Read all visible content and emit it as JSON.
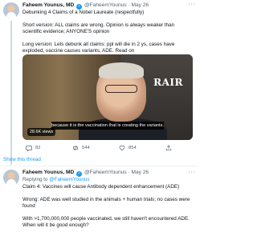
{
  "tweet1": {
    "author_name": "Faheem Younus, MD",
    "author_handle": "@FaheemYounus",
    "date": "May 26",
    "title_line": "Debunking 4 Claims of a Nobel Laureate (respectfully)",
    "para1": "Short version: ALL claims are wrong. Opinion is always weaker than scientific evidence; ANYONE'S opinion",
    "para2": "Long version: Lets debunk all claims: ppl will die in 2 ys, cases have exploded, vaccine causes variants, ADE. Read on",
    "video": {
      "logo": "RAIR",
      "caption": "because it is the vaccination that is creating the variants.",
      "views": "28.6K views"
    },
    "actions": {
      "replies": "82",
      "retweets": "544",
      "likes": "854"
    }
  },
  "show_thread": "Show this thread",
  "tweet2": {
    "author_name": "Faheem Younus, MD",
    "author_handle": "@FaheemYounus",
    "date": "May 26",
    "replying_label": "Replying to",
    "replying_handle": "@FaheemYounus",
    "claim": "Claim 4: Vaccines will cause Antibody dependent enhancement (ADE)",
    "wrong": "Wrong: ADE was well studied in the animals + human trials; no cases were found",
    "with": "With >1,700,000,000 people vaccinated, we still haven't encountered ADE. When will it be good enough?"
  }
}
